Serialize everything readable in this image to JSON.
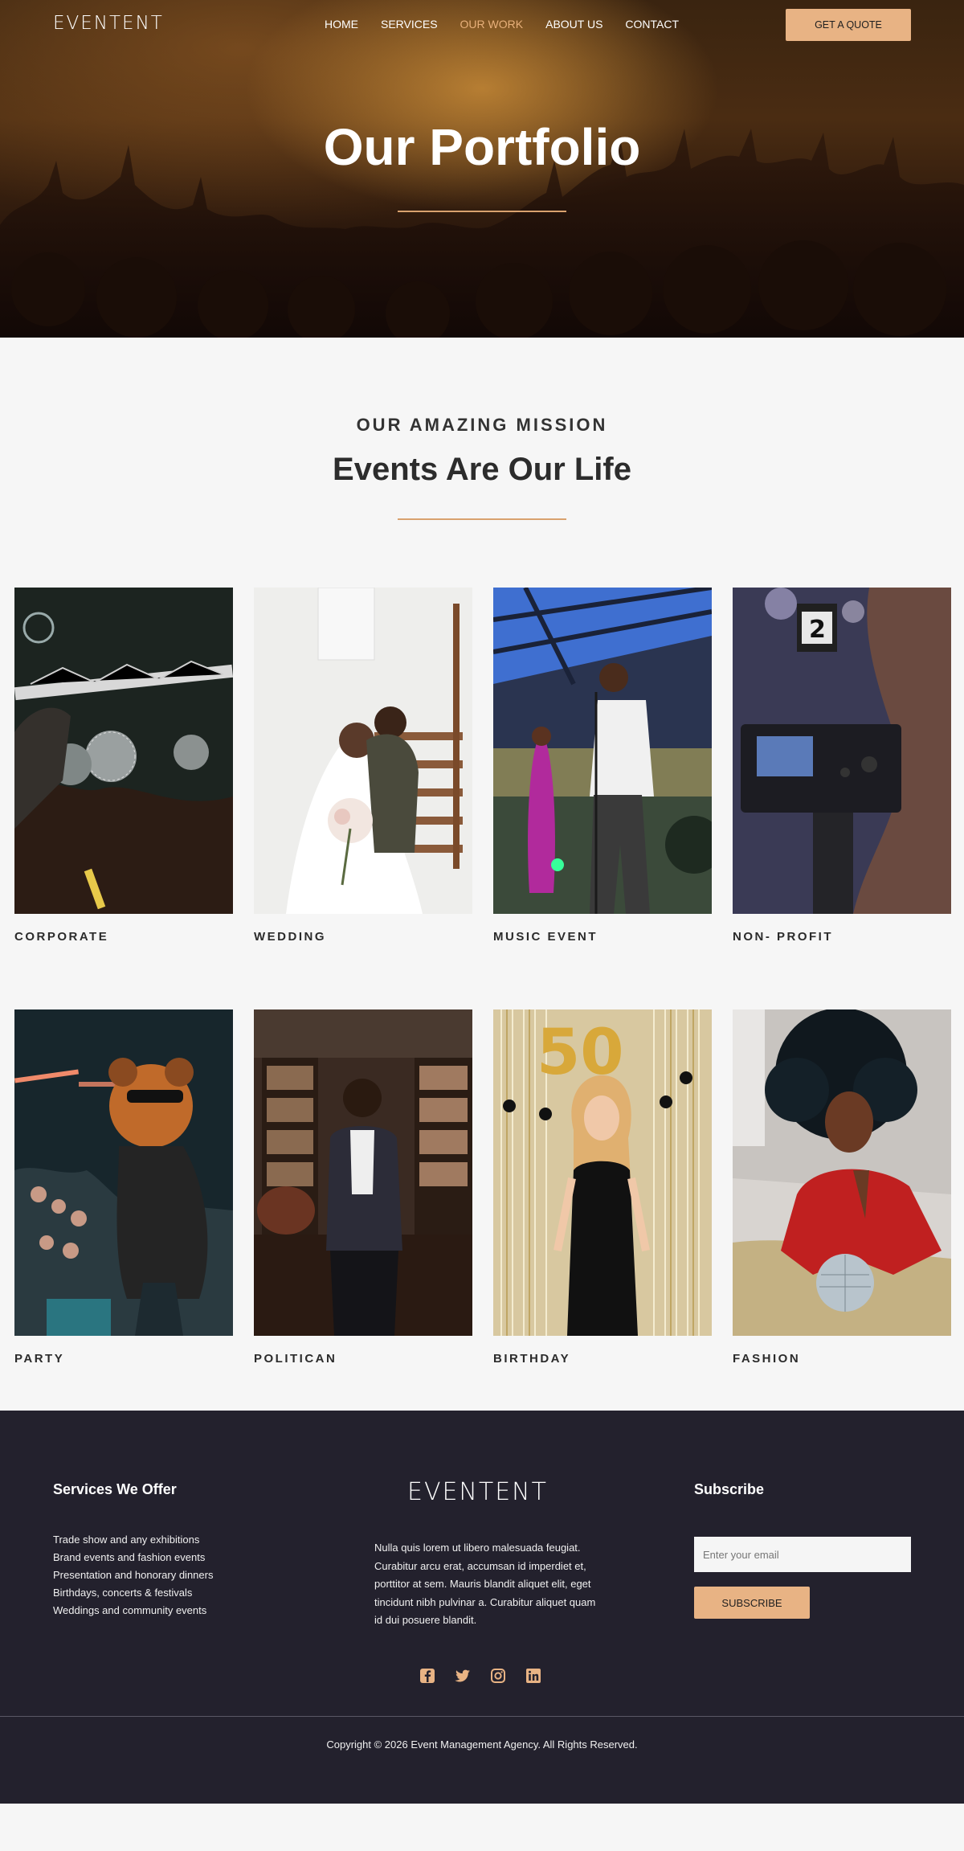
{
  "brand": {
    "logo": "EVENTENT",
    "accent": "#e8b384"
  },
  "nav": {
    "items": [
      {
        "label": "HOME",
        "active": false
      },
      {
        "label": "SERVICES",
        "active": false
      },
      {
        "label": "OUR WORK",
        "active": true
      },
      {
        "label": "ABOUT US",
        "active": false
      },
      {
        "label": "CONTACT",
        "active": false
      }
    ],
    "cta": "GET A QUOTE"
  },
  "hero": {
    "title": "Our Portfolio"
  },
  "mission": {
    "kicker": "OUR AMAZING MISSION",
    "title": "Events Are Our Life"
  },
  "portfolio": [
    {
      "label": "CORPORATE"
    },
    {
      "label": "WEDDING"
    },
    {
      "label": "MUSIC EVENT"
    },
    {
      "label": "NON- PROFIT"
    },
    {
      "label": "PARTY"
    },
    {
      "label": "POLITICAN"
    },
    {
      "label": "BIRTHDAY"
    },
    {
      "label": "FASHION"
    }
  ],
  "footer": {
    "services_title": "Services We Offer",
    "services": [
      "Trade show and any exhibitions",
      "Brand events and fashion events",
      "Presentation and honorary dinners",
      "Birthdays, concerts & festivals",
      "Weddings and community events"
    ],
    "logo": "EVENTENT",
    "about": "Nulla quis lorem ut libero malesuada feugiat. Curabitur arcu erat, accumsan id imperdiet et, porttitor at sem. Mauris blandit aliquet elit, eget tincidunt nibh pulvinar a. Curabitur aliquet quam id dui posuere blandit.",
    "subscribe_title": "Subscribe",
    "email_placeholder": "Enter your email",
    "subscribe_button": "SUBSCRIBE",
    "socials": [
      "facebook-icon",
      "twitter-icon",
      "instagram-icon",
      "linkedin-icon"
    ],
    "copyright": "Copyright © 2026 Event Management Agency. All Rights Reserved."
  }
}
